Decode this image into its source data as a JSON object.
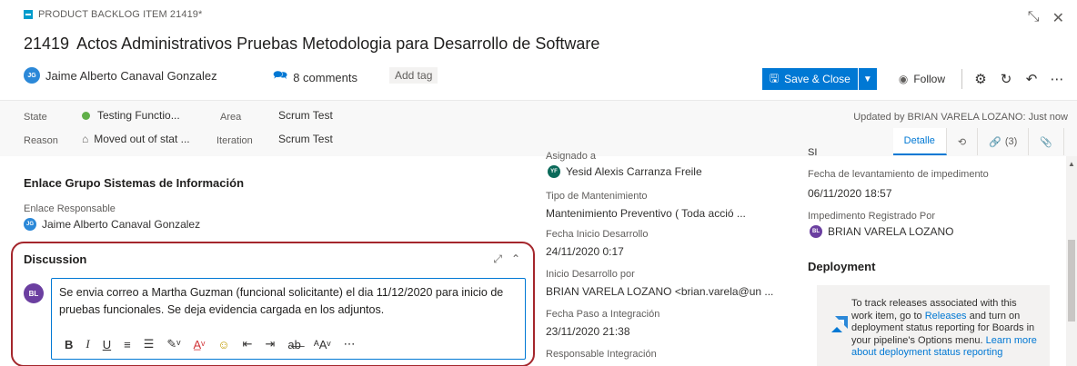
{
  "work_item": {
    "type_label": "PRODUCT BACKLOG ITEM 21419*",
    "id": "21419",
    "title": "Actos Administrativos Pruebas Metodologia para Desarrollo de Software",
    "assigned_initials": "JG",
    "assigned_name": "Jaime Alberto Canaval Gonzalez",
    "comments_label": "8 comments",
    "add_tag_label": "Add tag"
  },
  "window_controls": {
    "minimize": "⤡",
    "close": "✕"
  },
  "toolbar": {
    "save_label": "Save & Close",
    "follow_label": "Follow",
    "icons": [
      "gear-icon",
      "refresh-icon",
      "undo-icon",
      "more-icon"
    ]
  },
  "fields": {
    "state_label": "State",
    "state_value": "Testing Functio...",
    "state_color": "#60af49",
    "area_label": "Area",
    "area_value": "Scrum Test",
    "reason_label": "Reason",
    "reason_value": "Moved out of stat ...",
    "iteration_label": "Iteration",
    "iteration_value": "Scrum Test",
    "updated_text": "Updated by BRIAN VARELA LOZANO: Just now"
  },
  "tabs": [
    {
      "label": "Detalle",
      "active": true
    },
    {
      "label": "",
      "icon": "history-icon"
    },
    {
      "label": "(3)",
      "icon": "link-icon"
    },
    {
      "label": "",
      "icon": "attachment-icon"
    }
  ],
  "left_col": {
    "section_title": "Enlace Grupo Sistemas de Información",
    "responsable_label": "Enlace Responsable",
    "responsable_initials": "JG",
    "responsable_name": "Jaime Alberto Canaval Gonzalez"
  },
  "discussion": {
    "title": "Discussion",
    "avatar_initials": "BL",
    "text": "Se envia correo a Martha Guzman (funcional solicitante) el dia 11/12/2020 para inicio de pruebas funcionales. Se deja evidencia cargada en los adjuntos."
  },
  "mid_col": {
    "asignado_label": "Asignado a",
    "asignado_initials": "YF",
    "asignado_name": "Yesid Alexis Carranza Freile",
    "tipo_label": "Tipo de Mantenimiento",
    "tipo_value": "Mantenimiento Preventivo ( Toda acció ...",
    "fecha_inicio_label": "Fecha Inicio Desarrollo",
    "fecha_inicio_value": "24/11/2020 0:17",
    "inicio_por_label": "Inicio Desarrollo por",
    "inicio_por_value": "BRIAN VARELA LOZANO <brian.varela@un ...",
    "fecha_paso_label": "Fecha Paso a Integración",
    "fecha_paso_value": "23/11/2020 21:38",
    "responsable_int_label": "Responsable Integración"
  },
  "right_col": {
    "top_value": "SI",
    "fecha_imp_label": "Fecha de levantamiento de impedimento",
    "fecha_imp_value": "06/11/2020 18:57",
    "imp_por_label": "Impedimento Registrado Por",
    "imp_por_initials": "BL",
    "imp_por_name": "BRIAN VARELA LOZANO",
    "deployment_title": "Deployment",
    "deploy_text_1": "To track releases associated with this work item, go to ",
    "deploy_link_1": "Releases",
    "deploy_text_2": " and turn on deployment status reporting for Boards in your pipeline's Options menu. ",
    "deploy_link_2": "Learn more about deployment status reporting"
  }
}
